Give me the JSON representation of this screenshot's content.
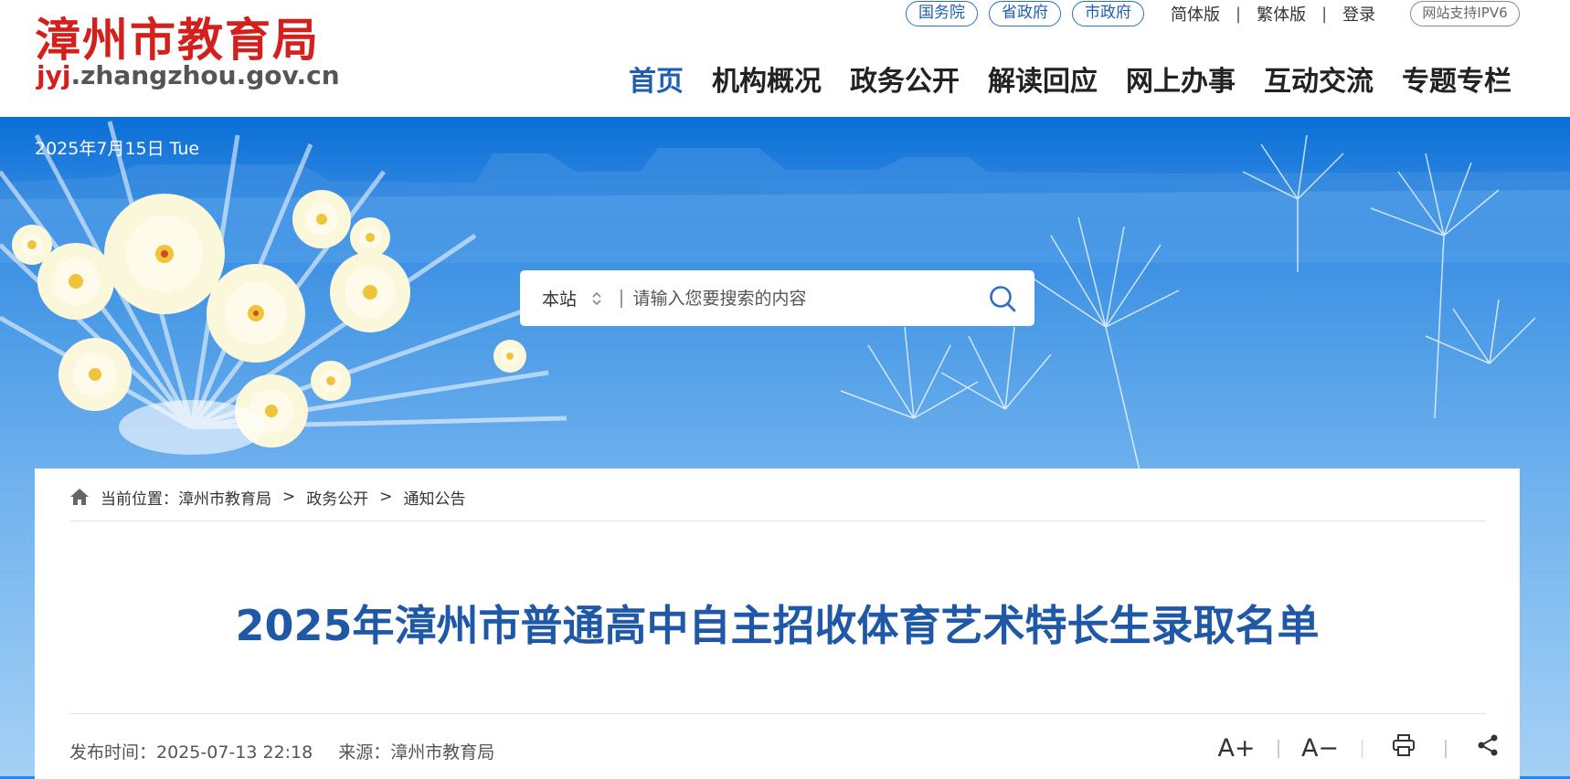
{
  "header": {
    "logo_cn": "漳州市教育局",
    "logo_url_prefix": "jyj",
    "logo_url_rest": ".zhangzhou.gov.cn",
    "gov_links": [
      "国务院",
      "省政府",
      "市政府"
    ],
    "util_links": [
      "简体版",
      "繁体版",
      "登录"
    ],
    "util_separator": "|",
    "ipv6_badge": "网站支持IPV6",
    "nav": [
      "首页",
      "机构概况",
      "政务公开",
      "解读回应",
      "网上办事",
      "互动交流",
      "专题专栏"
    ],
    "active_nav": "首页"
  },
  "banner": {
    "date": "2025年7月15日 Tue"
  },
  "search": {
    "scope": "本站",
    "placeholder": "请输入您要搜索的内容",
    "icon": "search-icon"
  },
  "breadcrumb": {
    "label": "当前位置：",
    "items": [
      "漳州市教育局",
      "政务公开",
      "通知公告"
    ],
    "separator": ">"
  },
  "article": {
    "title": "2025年漳州市普通高中自主招收体育艺术特长生录取名单",
    "publish_label": "发布时间：",
    "publish_time": "2025-07-13 22:18",
    "source_label": "来源：",
    "source": "漳州市教育局"
  },
  "tools": {
    "font_larger": "A+",
    "font_smaller": "A−",
    "print_icon": "print-icon",
    "share_icon": "share-icon"
  },
  "colors": {
    "logo_red": "#d4201c",
    "nav_active": "#1f5fb3",
    "title_blue": "#1e58a6",
    "banner_top": "#0a6fd6"
  }
}
